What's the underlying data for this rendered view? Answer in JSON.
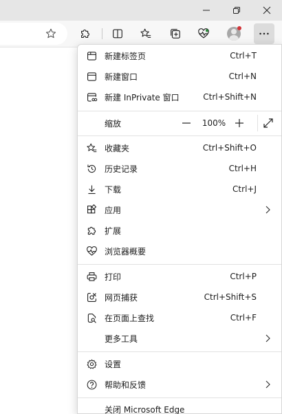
{
  "window": {
    "minimize_label": "—",
    "restore_icon": "restore-icon",
    "close_icon": "close-icon"
  },
  "toolbar": {
    "icons": [
      "star-outline-icon",
      "puzzle-icon",
      "split-screen-icon",
      "favorites-icon",
      "collections-icon",
      "health-icon",
      "profile-avatar",
      "more-icon"
    ]
  },
  "menu": {
    "new_tab": {
      "label": "新建标签页",
      "shortcut": "Ctrl+T"
    },
    "new_window": {
      "label": "新建窗口",
      "shortcut": "Ctrl+N"
    },
    "new_inprivate": {
      "label": "新建 InPrivate 窗口",
      "shortcut": "Ctrl+Shift+N"
    },
    "zoom": {
      "label": "缩放",
      "minus": "—",
      "value": "100%",
      "plus": "+"
    },
    "favorites": {
      "label": "收藏夹",
      "shortcut": "Ctrl+Shift+O"
    },
    "history": {
      "label": "历史记录",
      "shortcut": "Ctrl+H"
    },
    "downloads": {
      "label": "下载",
      "shortcut": "Ctrl+J"
    },
    "apps": {
      "label": "应用"
    },
    "extensions": {
      "label": "扩展"
    },
    "browser_essentials": {
      "label": "浏览器概要"
    },
    "print": {
      "label": "打印",
      "shortcut": "Ctrl+P"
    },
    "web_capture": {
      "label": "网页捕获",
      "shortcut": "Ctrl+Shift+S"
    },
    "find_on_page": {
      "label": "在页面上查找",
      "shortcut": "Ctrl+F"
    },
    "more_tools": {
      "label": "更多工具"
    },
    "settings": {
      "label": "设置"
    },
    "help_feedback": {
      "label": "帮助和反馈"
    },
    "close_edge": {
      "label": "关闭 Microsoft Edge"
    }
  },
  "colors": {
    "titlebar": "#e6e6e6",
    "toolbar": "#f7f7f7",
    "menu_bg": "#ffffff",
    "notification_dot": "#d13438"
  }
}
